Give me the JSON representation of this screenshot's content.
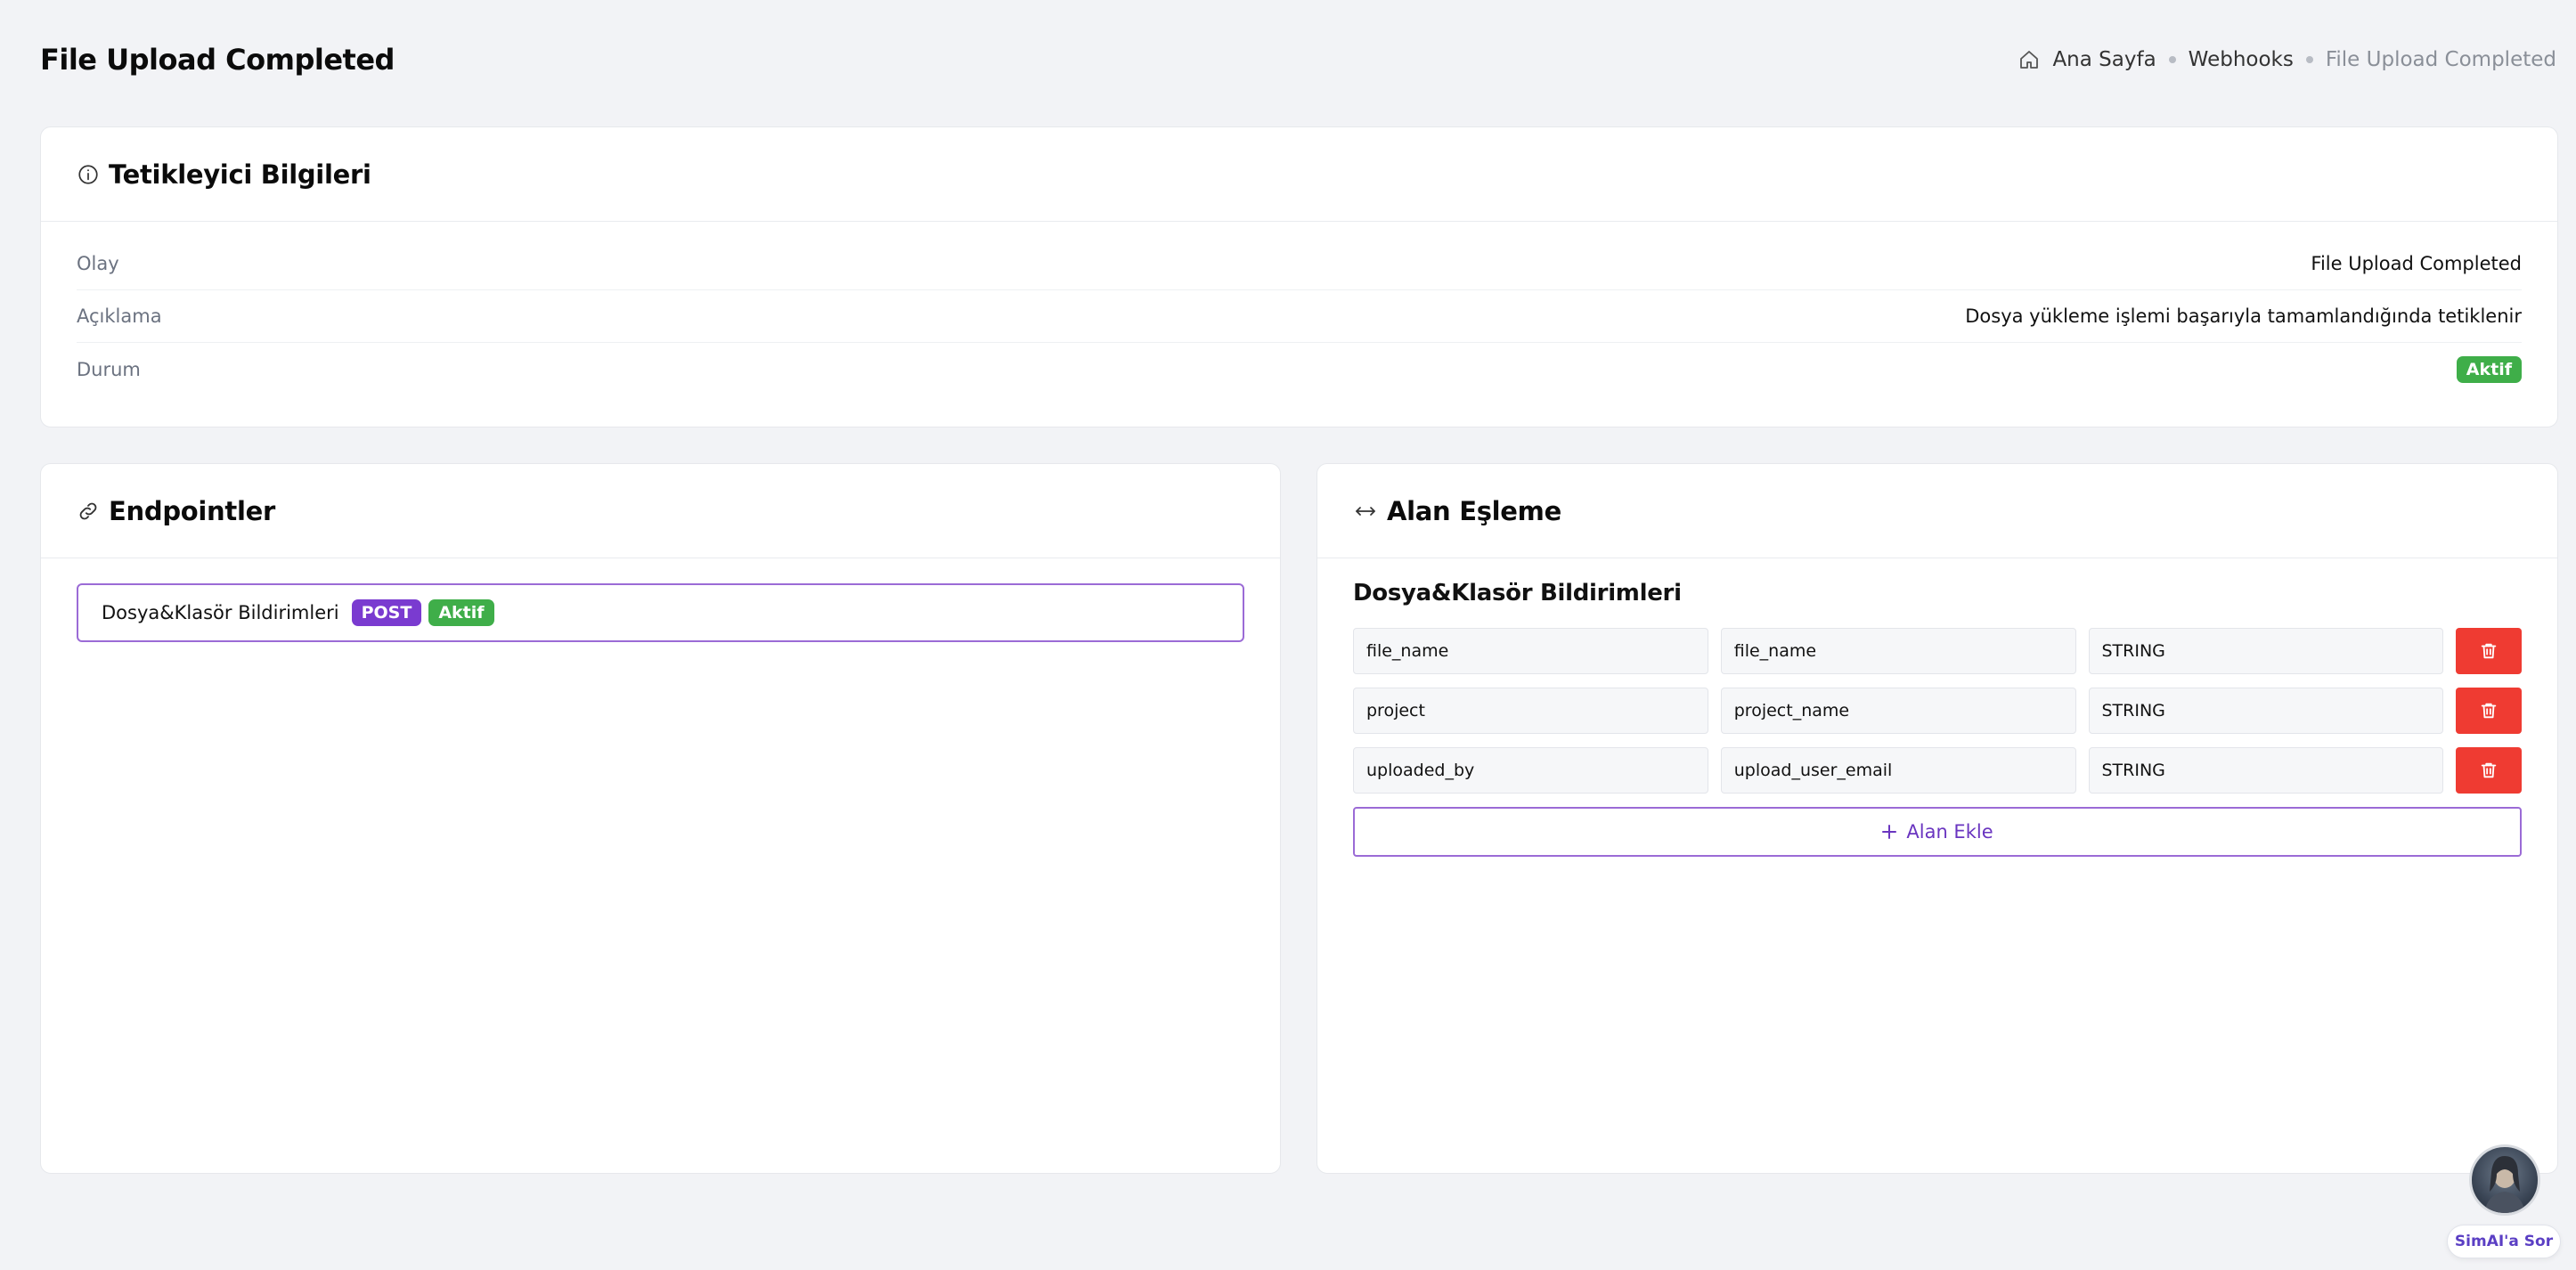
{
  "page": {
    "title": "File Upload Completed"
  },
  "breadcrumb": {
    "home": "Ana Sayfa",
    "section": "Webhooks",
    "current": "File Upload Completed"
  },
  "trigger_info": {
    "title": "Tetikleyici Bilgileri",
    "rows": [
      {
        "label": "Olay",
        "value": "File Upload Completed"
      },
      {
        "label": "Açıklama",
        "value": "Dosya yükleme işlemi başarıyla tamamlandığında tetiklenir"
      },
      {
        "label": "Durum",
        "value": "Aktif"
      }
    ]
  },
  "endpoints": {
    "title": "Endpointler",
    "items": [
      {
        "name": "Dosya&Klasör Bildirimleri",
        "method": "POST",
        "status": "Aktif"
      }
    ]
  },
  "mapping": {
    "title": "Alan Eşleme",
    "subtitle": "Dosya&Klasör Bildirimleri",
    "rows": [
      {
        "source": "file_name",
        "target": "file_name",
        "type": "STRING"
      },
      {
        "source": "project",
        "target": "project_name",
        "type": "STRING"
      },
      {
        "source": "uploaded_by",
        "target": "upload_user_email",
        "type": "STRING"
      }
    ],
    "add_label": "Alan Ekle"
  },
  "assistant": {
    "label": "SimAI'a Sor"
  },
  "colors": {
    "accent_purple": "#7a3bd0",
    "success_green": "#3fae49",
    "danger_red": "#ef3b32"
  }
}
